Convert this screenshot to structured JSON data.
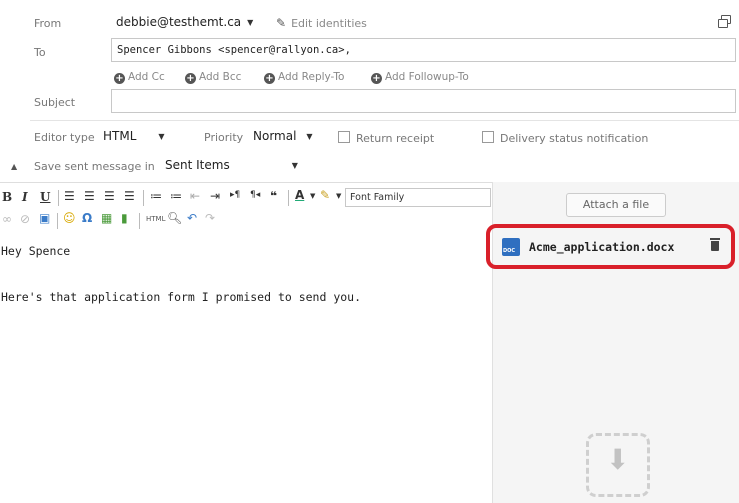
{
  "headers": {
    "from_label": "From",
    "from_value": "debbie@testhemt.ca",
    "edit_identities": "Edit identities",
    "to_label": "To",
    "to_value": "Spencer Gibbons <spencer@rallyon.ca>,",
    "add_cc": "Add Cc",
    "add_bcc": "Add Bcc",
    "add_reply_to": "Add Reply-To",
    "add_followup_to": "Add Followup-To",
    "subject_label": "Subject",
    "subject_value": ""
  },
  "options": {
    "editor_type_label": "Editor type",
    "editor_type_value": "HTML",
    "priority_label": "Priority",
    "priority_value": "Normal",
    "return_receipt": "Return receipt",
    "delivery_status": "Delivery status notification",
    "save_sent_label": "Save sent message in",
    "save_sent_value": "Sent Items"
  },
  "toolbar": {
    "font_family": "Font Family",
    "html_label": "HTML"
  },
  "body": {
    "line1": "Hey Spence",
    "line2": "Here's that application form I promised to send you."
  },
  "attachments": {
    "attach_button": "Attach a file",
    "file_name": "Acme_application.docx",
    "file_icon_text": "DOC",
    "highlight_color": "#d9202a"
  }
}
